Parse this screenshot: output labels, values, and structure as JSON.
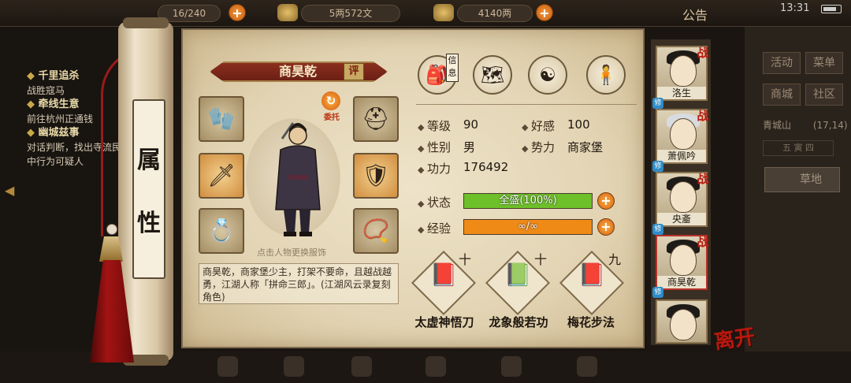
{
  "topbar": {
    "food": "16/240",
    "copper": "5两572文",
    "silver": "4140两",
    "announcement": "公告",
    "time": "13:31"
  },
  "quests": [
    {
      "title": "千里追杀",
      "desc": "战胜寇马"
    },
    {
      "title": "牵线生意",
      "desc": "前往杭州正通钱"
    },
    {
      "title": "幽城兹事",
      "desc": "对话判断，找出寺流民中行为可疑人"
    }
  ],
  "right_menu": {
    "buttons": [
      "活动",
      "菜单",
      "商城",
      "社区"
    ],
    "location": "青城山",
    "coords": "(17,14)",
    "time_of_day": "五 寅 四",
    "terrain": "草地"
  },
  "scroll": {
    "title_chars": [
      "属",
      "性"
    ]
  },
  "character": {
    "name": "商昊乾",
    "rate_label": "评",
    "entrust_label": "委托",
    "change_outfit_hint": "点击人物更换服饰",
    "description": "商昊乾，商家堡少主，打架不要命，且越战越勇，江湖人称「拼命三郎」。(江湖风云录复刻角色)"
  },
  "top_icons": {
    "tag": "信息",
    "names": [
      "bag-icon",
      "map-icon",
      "bagua-icon",
      "body-icon"
    ]
  },
  "stats": {
    "level_label": "等级",
    "level": "90",
    "favor_label": "好感",
    "favor": "100",
    "gender_label": "性别",
    "gender": "男",
    "faction_label": "势力",
    "faction": "商家堡",
    "power_label": "功力",
    "power": "176492"
  },
  "bars": {
    "status_label": "状态",
    "status_text": "全盛(100%)",
    "status_fraction": 1.0,
    "status_color": "#6ec02a",
    "exp_label": "经验",
    "exp_text": "∞/∞",
    "exp_fraction": 1.0,
    "exp_color": "#f08a17"
  },
  "skills": [
    {
      "name": "太虚神悟刀",
      "level": "十",
      "icon": "red-book-icon"
    },
    {
      "name": "龙象般若功",
      "level": "十",
      "icon": "green-book-icon"
    },
    {
      "name": "梅花步法",
      "level": "九",
      "icon": "red-book-icon"
    }
  ],
  "roster": [
    {
      "name": "洛生",
      "tag": "战",
      "badge": "修"
    },
    {
      "name": "萧佩吟",
      "tag": "战",
      "badge": "修"
    },
    {
      "name": "央齑",
      "tag": "战",
      "badge": "修"
    },
    {
      "name": "商昊乾",
      "tag": "战",
      "badge": "修"
    }
  ],
  "leave_label": "离开"
}
